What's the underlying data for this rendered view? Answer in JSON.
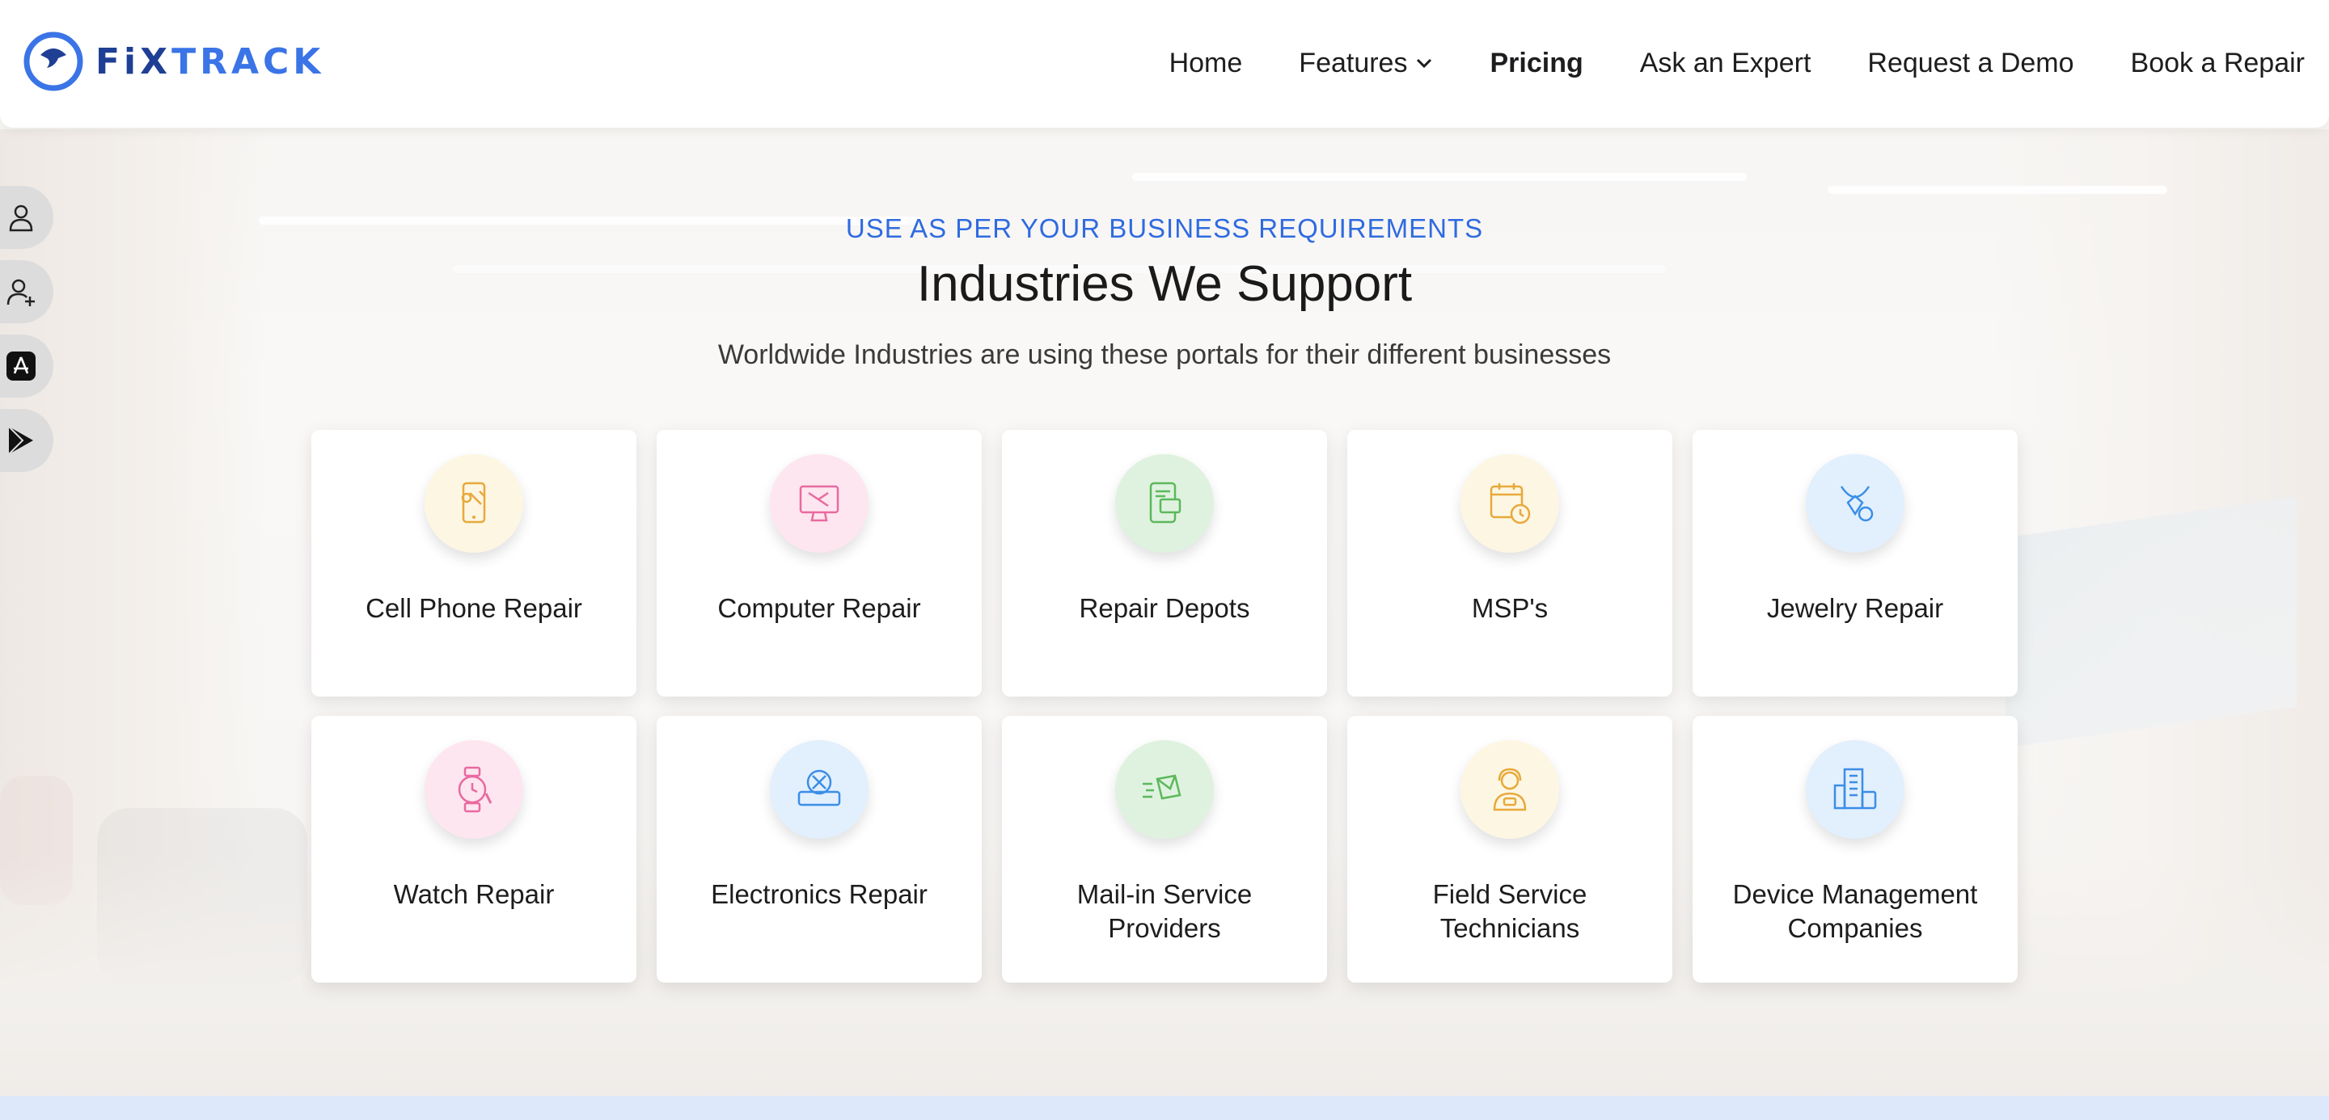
{
  "brand": {
    "name_part1": "FiX",
    "name_part2": "TRACK",
    "accent": "#3a74e6",
    "dark": "#1f3f94"
  },
  "nav": {
    "items": [
      {
        "label": "Home"
      },
      {
        "label": "Features"
      },
      {
        "label": "Pricing"
      },
      {
        "label": "Ask an Expert"
      },
      {
        "label": "Request a Demo"
      },
      {
        "label": "Book a Repair"
      }
    ]
  },
  "rail": [
    {
      "icon": "user-icon"
    },
    {
      "icon": "user-add-icon"
    },
    {
      "icon": "app-store-icon"
    },
    {
      "icon": "google-play-icon"
    }
  ],
  "section": {
    "eyebrow": "USE AS PER YOUR BUSINESS REQUIREMENTS",
    "title": "Industries We Support",
    "subtitle": "Worldwide Industries are using these portals for their different businesses"
  },
  "industries": [
    {
      "label": "Cell Phone Repair",
      "icon": "phone-repair-icon",
      "bg": "#fdf6e3",
      "stroke": "#e8a93a"
    },
    {
      "label": "Computer Repair",
      "icon": "computer-repair-icon",
      "bg": "#fde6ef",
      "stroke": "#e86aa0"
    },
    {
      "label": "Repair Depots",
      "icon": "repair-depot-icon",
      "bg": "#dff2df",
      "stroke": "#5cb85c"
    },
    {
      "label": "MSP's",
      "icon": "calendar-clock-icon",
      "bg": "#fdf6e3",
      "stroke": "#e8a93a"
    },
    {
      "label": "Jewelry Repair",
      "icon": "jewelry-icon",
      "bg": "#e2effd",
      "stroke": "#3a8ee6"
    },
    {
      "label": "Watch Repair",
      "icon": "watch-repair-icon",
      "bg": "#fde6ef",
      "stroke": "#e86aa0"
    },
    {
      "label": "Electronics Repair",
      "icon": "electronics-repair-icon",
      "bg": "#e2effd",
      "stroke": "#3a8ee6"
    },
    {
      "label": "Mail-in Service Providers",
      "icon": "mail-in-icon",
      "bg": "#dff2df",
      "stroke": "#5cb85c"
    },
    {
      "label": "Field Service Technicians",
      "icon": "technician-icon",
      "bg": "#fdf6e3",
      "stroke": "#e8a93a"
    },
    {
      "label": "Device Management Companies",
      "icon": "building-icon",
      "bg": "#e2effd",
      "stroke": "#3a8ee6"
    }
  ]
}
